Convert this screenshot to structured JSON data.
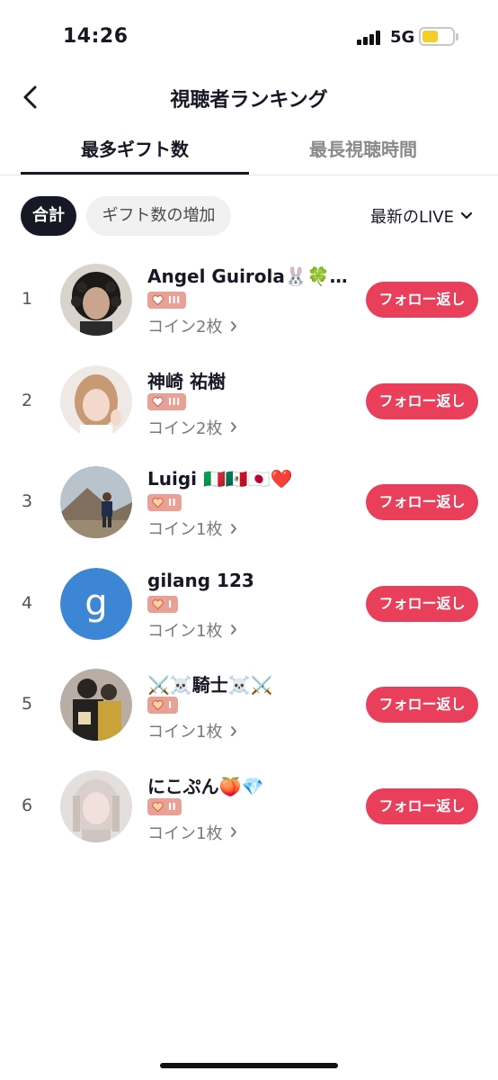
{
  "status_bar": {
    "time": "14:26",
    "network": "5G"
  },
  "header": {
    "title": "視聴者ランキング"
  },
  "tabs": [
    {
      "label": "最多ギフト数",
      "active": true
    },
    {
      "label": "最長視聴時間",
      "active": false
    }
  ],
  "filters": {
    "chips": [
      "合計",
      "ギフト数の増加"
    ],
    "selected_chip": "合計",
    "live_select": "最新のLIVE"
  },
  "viewers": [
    {
      "rank": "1",
      "name": "Angel Guirola🐰🍀…",
      "level": "III",
      "coins": "コイン2枚",
      "follow_label": "フォロー返し"
    },
    {
      "rank": "2",
      "name": "神崎 祐樹",
      "level": "III",
      "coins": "コイン2枚",
      "follow_label": "フォロー返し"
    },
    {
      "rank": "3",
      "name": "Luigi 🇮🇹🇲🇽🇯🇵❤️",
      "level": "II",
      "coins": "コイン1枚",
      "follow_label": "フォロー返し"
    },
    {
      "rank": "4",
      "name": "gilang 123",
      "level": "I",
      "coins": "コイン1枚",
      "follow_label": "フォロー返し",
      "avatar_letter": "g"
    },
    {
      "rank": "5",
      "name": "⚔️☠️騎士☠️⚔️",
      "level": "I",
      "coins": "コイン1枚",
      "follow_label": "フォロー返し"
    },
    {
      "rank": "6",
      "name": "にこぷん🍑💎",
      "level": "II",
      "coins": "コイン1枚",
      "follow_label": "フォロー返し"
    }
  ],
  "colors": {
    "accent": "#ea3f5a",
    "badge": "#e9a196",
    "letter_avatar": "#3d86d6",
    "battery": "#f5cd2a"
  },
  "icons": {
    "back": "chevron-left-icon",
    "dropdown": "chevron-down-icon",
    "coins_more": "chevron-right-icon",
    "badge": "heart-icon"
  }
}
